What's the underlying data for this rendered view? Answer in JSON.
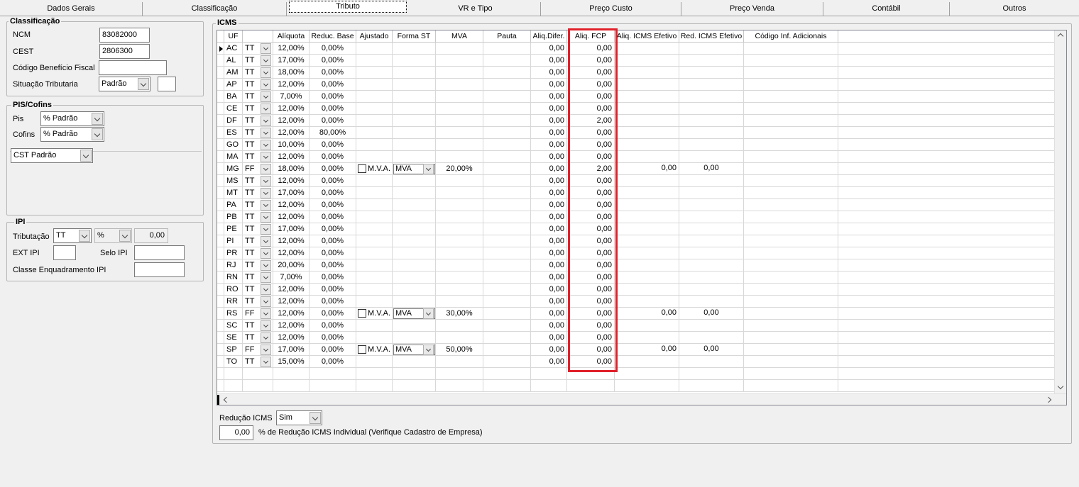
{
  "tabs": [
    "Dados Gerais",
    "Classificação",
    "Tributo",
    "VR e Tipo",
    "Preço Custo",
    "Preço Venda",
    "Contábil",
    "Outros"
  ],
  "classificacao": {
    "legend": "Classificação",
    "ncm_label": "NCM",
    "ncm": "83082000",
    "cest_label": "CEST",
    "cest": "2806300",
    "cbf_label": "Código Benefício Fiscal",
    "cbf": "",
    "sit_label": "Situação Tributaria",
    "sit": "Padrão",
    "sit_extra": ""
  },
  "pis": {
    "legend": "PIS/Cofins",
    "pis_label": "Pis",
    "pis": "% Padrão",
    "cofins_label": "Cofins",
    "cofins": "% Padrão",
    "cst": "CST Padrão"
  },
  "ipi": {
    "legend": "IPI",
    "trib_label": "Tributação",
    "trib": "TT",
    "pct": "%",
    "value": "0,00",
    "ext_label": "EXT IPI",
    "ext": "",
    "selo_label": "Selo IPI",
    "selo": "",
    "classe_label": "Classe Enquadramento IPI",
    "classe": ""
  },
  "icms": {
    "legend": "ICMS",
    "headers": [
      "UF",
      "",
      "Alíquota",
      "Reduc. Base",
      "Ajustado",
      "Forma ST",
      "MVA",
      "Pauta",
      "Aliq.Difer.",
      "Aliq. FCP",
      "Aliq. ICMS Efetivo",
      "Red. ICMS Efetivo",
      "Código Inf. Adicionais"
    ],
    "rows": [
      {
        "uf": "AC",
        "t": "TT",
        "aliq": "12,00%",
        "red": "0,00%",
        "mva_flag": "",
        "forma": "",
        "mva": "",
        "dif": "0,00",
        "fcp": "0,00",
        "ef": "",
        "red_ef": ""
      },
      {
        "uf": "AL",
        "t": "TT",
        "aliq": "17,00%",
        "red": "0,00%",
        "mva_flag": "",
        "forma": "",
        "mva": "",
        "dif": "0,00",
        "fcp": "0,00",
        "ef": "",
        "red_ef": ""
      },
      {
        "uf": "AM",
        "t": "TT",
        "aliq": "18,00%",
        "red": "0,00%",
        "mva_flag": "",
        "forma": "",
        "mva": "",
        "dif": "0,00",
        "fcp": "0,00",
        "ef": "",
        "red_ef": ""
      },
      {
        "uf": "AP",
        "t": "TT",
        "aliq": "12,00%",
        "red": "0,00%",
        "mva_flag": "",
        "forma": "",
        "mva": "",
        "dif": "0,00",
        "fcp": "0,00",
        "ef": "",
        "red_ef": ""
      },
      {
        "uf": "BA",
        "t": "TT",
        "aliq": "7,00%",
        "red": "0,00%",
        "mva_flag": "",
        "forma": "",
        "mva": "",
        "dif": "0,00",
        "fcp": "0,00",
        "ef": "",
        "red_ef": ""
      },
      {
        "uf": "CE",
        "t": "TT",
        "aliq": "12,00%",
        "red": "0,00%",
        "mva_flag": "",
        "forma": "",
        "mva": "",
        "dif": "0,00",
        "fcp": "0,00",
        "ef": "",
        "red_ef": ""
      },
      {
        "uf": "DF",
        "t": "TT",
        "aliq": "12,00%",
        "red": "0,00%",
        "mva_flag": "",
        "forma": "",
        "mva": "",
        "dif": "0,00",
        "fcp": "2,00",
        "ef": "",
        "red_ef": ""
      },
      {
        "uf": "ES",
        "t": "TT",
        "aliq": "12,00%",
        "red": "80,00%",
        "mva_flag": "",
        "forma": "",
        "mva": "",
        "dif": "0,00",
        "fcp": "0,00",
        "ef": "",
        "red_ef": ""
      },
      {
        "uf": "GO",
        "t": "TT",
        "aliq": "10,00%",
        "red": "0,00%",
        "mva_flag": "",
        "forma": "",
        "mva": "",
        "dif": "0,00",
        "fcp": "0,00",
        "ef": "",
        "red_ef": ""
      },
      {
        "uf": "MA",
        "t": "TT",
        "aliq": "12,00%",
        "red": "0,00%",
        "mva_flag": "",
        "forma": "",
        "mva": "",
        "dif": "0,00",
        "fcp": "0,00",
        "ef": "",
        "red_ef": ""
      },
      {
        "uf": "MG",
        "t": "FF",
        "aliq": "18,00%",
        "red": "0,00%",
        "mva_flag": "M.V.A.",
        "forma": "MVA",
        "mva": "20,00%",
        "dif": "0,00",
        "fcp": "2,00",
        "ef": "0,00",
        "red_ef": "0,00"
      },
      {
        "uf": "MS",
        "t": "TT",
        "aliq": "12,00%",
        "red": "0,00%",
        "mva_flag": "",
        "forma": "",
        "mva": "",
        "dif": "0,00",
        "fcp": "0,00",
        "ef": "",
        "red_ef": ""
      },
      {
        "uf": "MT",
        "t": "TT",
        "aliq": "17,00%",
        "red": "0,00%",
        "mva_flag": "",
        "forma": "",
        "mva": "",
        "dif": "0,00",
        "fcp": "0,00",
        "ef": "",
        "red_ef": ""
      },
      {
        "uf": "PA",
        "t": "TT",
        "aliq": "12,00%",
        "red": "0,00%",
        "mva_flag": "",
        "forma": "",
        "mva": "",
        "dif": "0,00",
        "fcp": "0,00",
        "ef": "",
        "red_ef": ""
      },
      {
        "uf": "PB",
        "t": "TT",
        "aliq": "12,00%",
        "red": "0,00%",
        "mva_flag": "",
        "forma": "",
        "mva": "",
        "dif": "0,00",
        "fcp": "0,00",
        "ef": "",
        "red_ef": ""
      },
      {
        "uf": "PE",
        "t": "TT",
        "aliq": "17,00%",
        "red": "0,00%",
        "mva_flag": "",
        "forma": "",
        "mva": "",
        "dif": "0,00",
        "fcp": "0,00",
        "ef": "",
        "red_ef": ""
      },
      {
        "uf": "PI",
        "t": "TT",
        "aliq": "12,00%",
        "red": "0,00%",
        "mva_flag": "",
        "forma": "",
        "mva": "",
        "dif": "0,00",
        "fcp": "0,00",
        "ef": "",
        "red_ef": ""
      },
      {
        "uf": "PR",
        "t": "TT",
        "aliq": "12,00%",
        "red": "0,00%",
        "mva_flag": "",
        "forma": "",
        "mva": "",
        "dif": "0,00",
        "fcp": "0,00",
        "ef": "",
        "red_ef": ""
      },
      {
        "uf": "RJ",
        "t": "TT",
        "aliq": "20,00%",
        "red": "0,00%",
        "mva_flag": "",
        "forma": "",
        "mva": "",
        "dif": "0,00",
        "fcp": "0,00",
        "ef": "",
        "red_ef": ""
      },
      {
        "uf": "RN",
        "t": "TT",
        "aliq": "7,00%",
        "red": "0,00%",
        "mva_flag": "",
        "forma": "",
        "mva": "",
        "dif": "0,00",
        "fcp": "0,00",
        "ef": "",
        "red_ef": ""
      },
      {
        "uf": "RO",
        "t": "TT",
        "aliq": "12,00%",
        "red": "0,00%",
        "mva_flag": "",
        "forma": "",
        "mva": "",
        "dif": "0,00",
        "fcp": "0,00",
        "ef": "",
        "red_ef": ""
      },
      {
        "uf": "RR",
        "t": "TT",
        "aliq": "12,00%",
        "red": "0,00%",
        "mva_flag": "",
        "forma": "",
        "mva": "",
        "dif": "0,00",
        "fcp": "0,00",
        "ef": "",
        "red_ef": ""
      },
      {
        "uf": "RS",
        "t": "FF",
        "aliq": "12,00%",
        "red": "0,00%",
        "mva_flag": "M.V.A.",
        "forma": "MVA",
        "mva": "30,00%",
        "dif": "0,00",
        "fcp": "0,00",
        "ef": "0,00",
        "red_ef": "0,00"
      },
      {
        "uf": "SC",
        "t": "TT",
        "aliq": "12,00%",
        "red": "0,00%",
        "mva_flag": "",
        "forma": "",
        "mva": "",
        "dif": "0,00",
        "fcp": "0,00",
        "ef": "",
        "red_ef": ""
      },
      {
        "uf": "SE",
        "t": "TT",
        "aliq": "12,00%",
        "red": "0,00%",
        "mva_flag": "",
        "forma": "",
        "mva": "",
        "dif": "0,00",
        "fcp": "0,00",
        "ef": "",
        "red_ef": ""
      },
      {
        "uf": "SP",
        "t": "FF",
        "aliq": "17,00%",
        "red": "0,00%",
        "mva_flag": "M.V.A.",
        "forma": "MVA",
        "mva": "50,00%",
        "dif": "0,00",
        "fcp": "0,00",
        "ef": "0,00",
        "red_ef": "0,00"
      },
      {
        "uf": "TO",
        "t": "TT",
        "aliq": "15,00%",
        "red": "0,00%",
        "mva_flag": "",
        "forma": "",
        "mva": "",
        "dif": "0,00",
        "fcp": "0,00",
        "ef": "",
        "red_ef": ""
      }
    ]
  },
  "footer": {
    "red_label": "Redução ICMS",
    "red": "Sim",
    "pct": "0,00",
    "pct_label": "% de Redução ICMS Individual (Verifique Cadastro de Empresa)"
  },
  "highlight_color": "#e0202a"
}
